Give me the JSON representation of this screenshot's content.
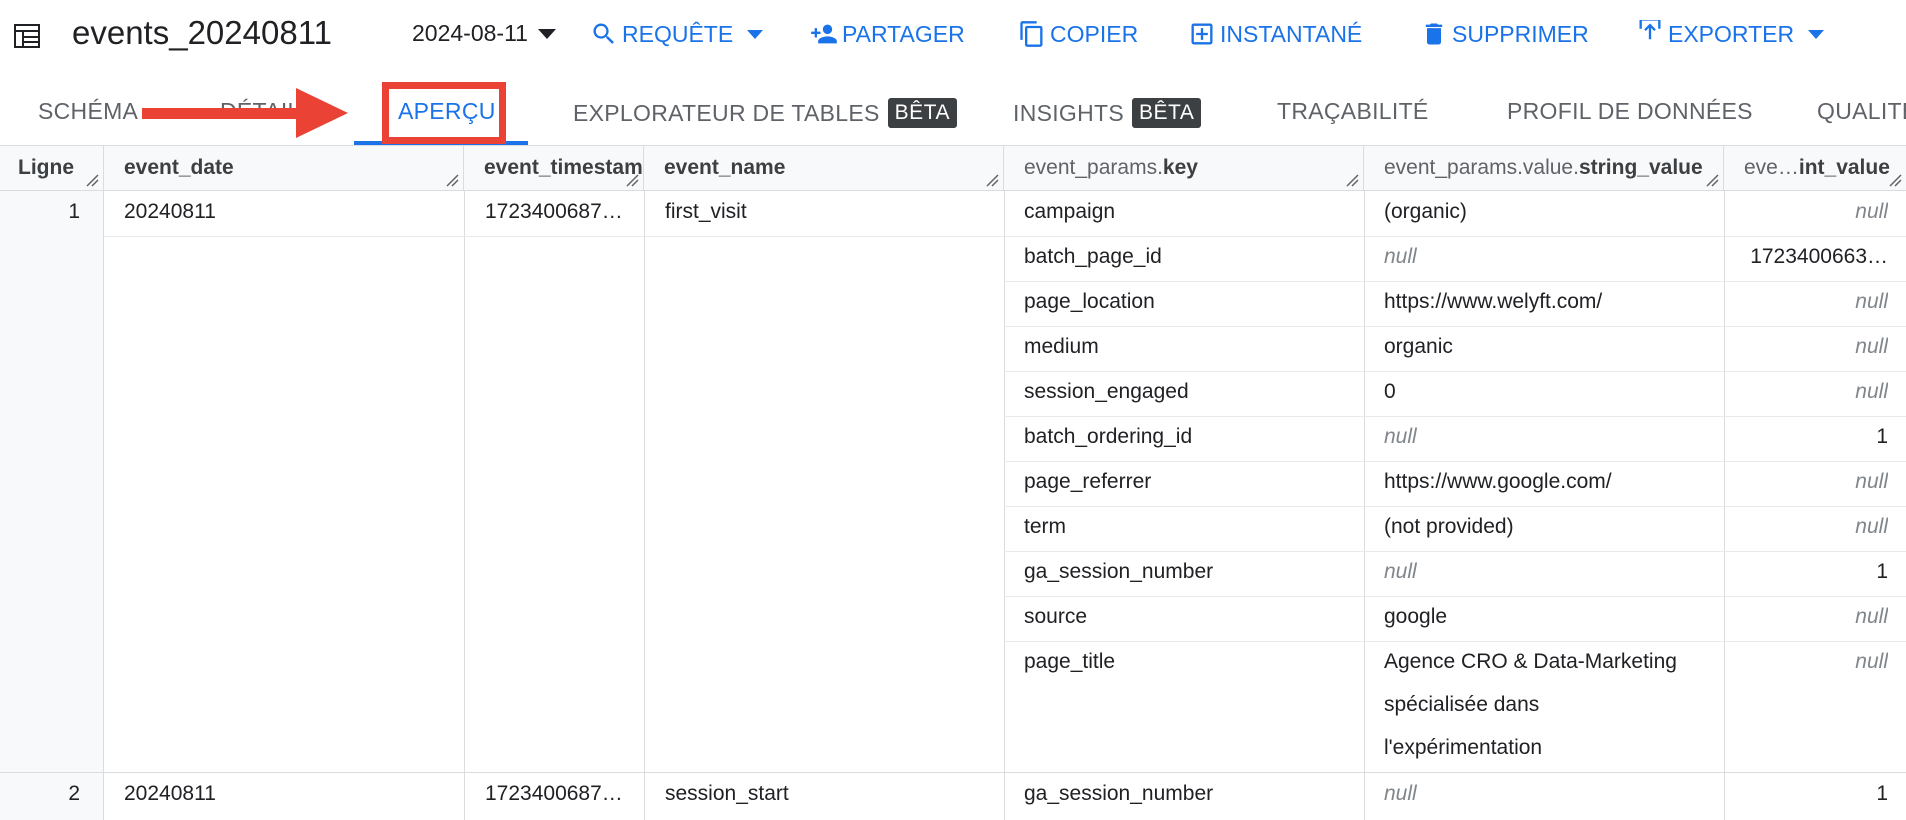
{
  "toolbar": {
    "title": "events_20240811",
    "date": "2024-08-11",
    "query_label": "REQUÊTE",
    "share_label": "PARTAGER",
    "copy_label": "COPIER",
    "snapshot_label": "INSTANTANÉ",
    "delete_label": "SUPPRIMER",
    "export_label": "EXPORTER"
  },
  "tabs": {
    "schema": "SCHÉMA",
    "details": "DÉTAILS",
    "preview": "APERÇU",
    "explorer": "EXPLORATEUR DE TABLES",
    "explorer_badge": "BÊTA",
    "insights": "INSIGHTS",
    "insights_badge": "BÊTA",
    "lineage": "TRAÇABILITÉ",
    "profile": "PROFIL DE DONNÉES",
    "quality": "QUALITÉ"
  },
  "columns": {
    "ligne": "Ligne",
    "event_date": "event_date",
    "event_timestamp": "event_timestamp",
    "event_name": "event_name",
    "params_key_prefix": "event_params.",
    "params_key": "key",
    "params_string_prefix": "event_params.value.",
    "params_string": "string_value",
    "params_int_prefix": "eve…",
    "params_int": "int_value"
  },
  "rows": [
    {
      "num": "1",
      "event_date": "20240811",
      "event_timestamp": "1723400687…",
      "event_name": "first_visit"
    },
    {
      "num": "2",
      "event_date": "20240811",
      "event_timestamp": "1723400687…",
      "event_name": "session_start"
    }
  ],
  "params": [
    {
      "key": "campaign",
      "string": "(organic)",
      "int": "null"
    },
    {
      "key": "batch_page_id",
      "string": "null",
      "int": "1723400663…"
    },
    {
      "key": "page_location",
      "string": "https://www.welyft.com/",
      "int": "null"
    },
    {
      "key": "medium",
      "string": "organic",
      "int": "null"
    },
    {
      "key": "session_engaged",
      "string": "0",
      "int": "null"
    },
    {
      "key": "batch_ordering_id",
      "string": "null",
      "int": "1"
    },
    {
      "key": "page_referrer",
      "string": "https://www.google.com/",
      "int": "null"
    },
    {
      "key": "term",
      "string": "(not provided)",
      "int": "null"
    },
    {
      "key": "ga_session_number",
      "string": "null",
      "int": "1"
    },
    {
      "key": "source",
      "string": "google",
      "int": "null"
    },
    {
      "key": "page_title",
      "string_lines": [
        "Agence CRO & Data-Marketing",
        "spécialisée dans",
        "l'expérimentation"
      ],
      "int": "null"
    }
  ],
  "row2_params": [
    {
      "key": "ga_session_number",
      "string": "null",
      "int": "1"
    }
  ]
}
